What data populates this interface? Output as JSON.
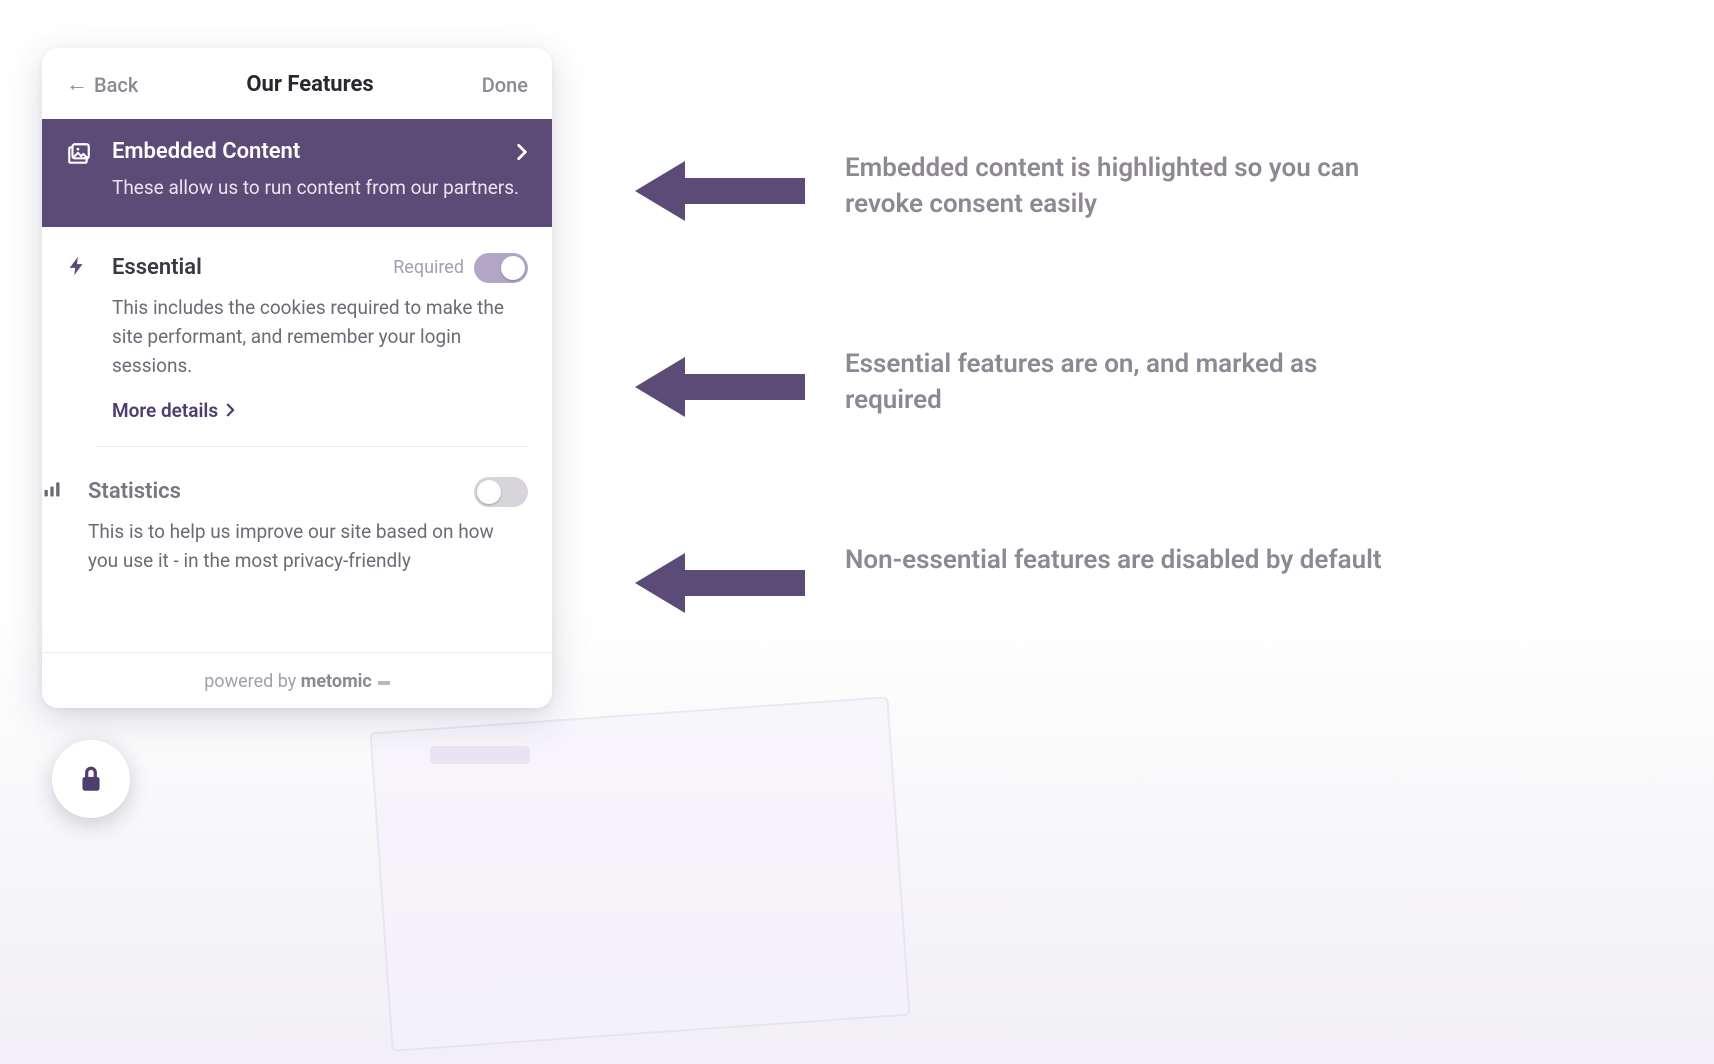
{
  "colors": {
    "accent": "#5c4a77",
    "muted": "#8d8894"
  },
  "header": {
    "back_label": "Back",
    "title": "Our Features",
    "done_label": "Done"
  },
  "sections": {
    "embedded": {
      "icon": "images-icon",
      "title": "Embedded Content",
      "desc": "These allow us to run content from our partners."
    },
    "essential": {
      "icon": "bolt-icon",
      "title": "Essential",
      "required_label": "Required",
      "toggle_on": true,
      "toggle_locked": true,
      "desc": "This includes the cookies required to make the site performant, and remember your login sessions.",
      "more_label": "More details"
    },
    "statistics": {
      "icon": "bars-icon",
      "title": "Statistics",
      "toggle_on": false,
      "toggle_locked": false,
      "desc": "This is to help us improve our site based on how you use it - in the most privacy-friendly"
    }
  },
  "footer": {
    "prefix": "powered by ",
    "brand": "metomic"
  },
  "annotations": [
    "Embedded content is highlighted so you can revoke consent easily",
    "Essential features are on, and marked as required",
    "Non-essential features are disabled by default"
  ]
}
